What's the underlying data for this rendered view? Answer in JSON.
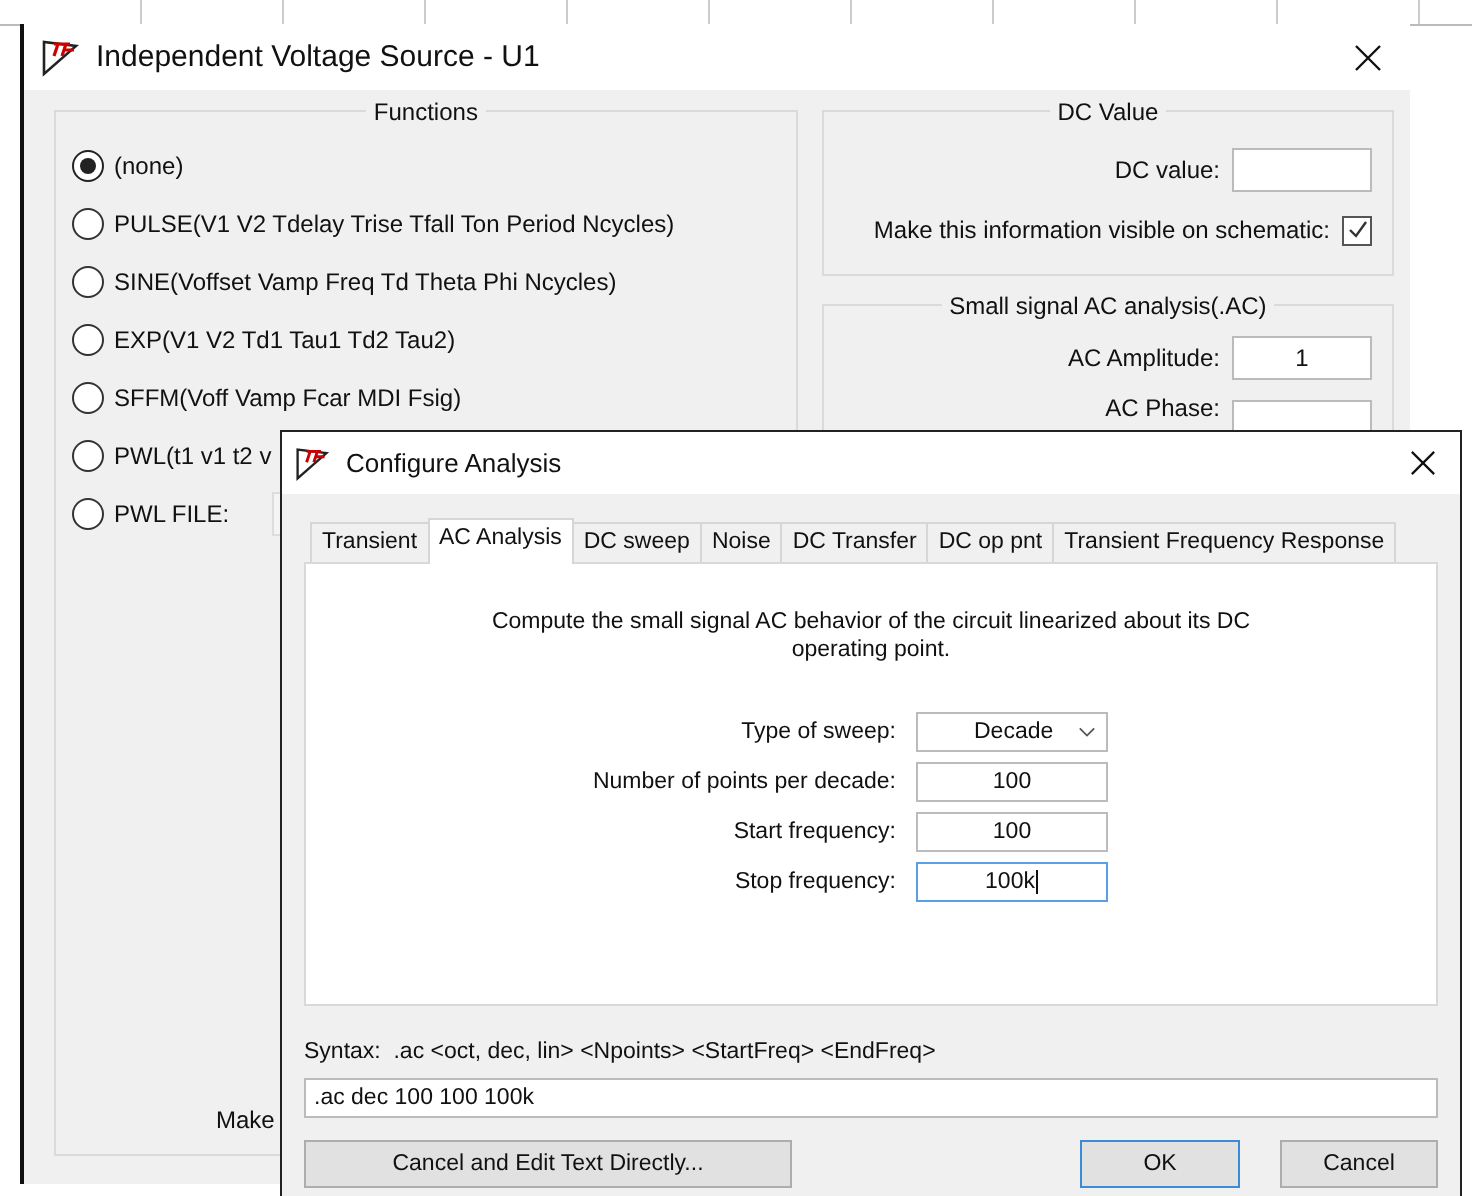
{
  "back_window": {
    "title": "Independent Voltage Source - U1",
    "functions": {
      "title": "Functions",
      "options": [
        {
          "label": "(none)",
          "selected": true
        },
        {
          "label": "PULSE(V1 V2 Tdelay Trise Tfall Ton Period Ncycles)",
          "selected": false
        },
        {
          "label": "SINE(Voffset Vamp Freq Td Theta Phi Ncycles)",
          "selected": false
        },
        {
          "label": "EXP(V1 V2 Td1 Tau1 Td2 Tau2)",
          "selected": false
        },
        {
          "label": "SFFM(Voff Vamp Fcar MDI Fsig)",
          "selected": false
        },
        {
          "label": "PWL(t1 v1 t2 v",
          "selected": false
        },
        {
          "label": "PWL FILE:",
          "selected": false
        }
      ]
    },
    "dc_value": {
      "title": "DC Value",
      "field_label": "DC value:",
      "visible_label": "Make this information visible on schematic:",
      "visible_checked": true
    },
    "ac": {
      "title": "Small signal AC analysis(.AC)",
      "amplitude_label": "AC Amplitude:",
      "amplitude": "1",
      "phase_label": "AC Phase:"
    },
    "bottom_label": "Make"
  },
  "front_window": {
    "title": "Configure Analysis",
    "tabs": [
      {
        "label": "Transient",
        "selected": false
      },
      {
        "label": "AC Analysis",
        "selected": true
      },
      {
        "label": "DC sweep",
        "selected": false
      },
      {
        "label": "Noise",
        "selected": false
      },
      {
        "label": "DC Transfer",
        "selected": false
      },
      {
        "label": "DC op pnt",
        "selected": false
      },
      {
        "label": "Transient Frequency Response",
        "selected": false
      }
    ],
    "description": "Compute the small signal AC behavior of the circuit linearized about its DC operating point.",
    "fields": [
      {
        "kind": "select",
        "label": "Type of sweep:",
        "value": "Decade",
        "focused": false
      },
      {
        "kind": "text",
        "label": "Number of points per decade:",
        "value": "100",
        "focused": false
      },
      {
        "kind": "text",
        "label": "Start frequency:",
        "value": "100",
        "focused": false
      },
      {
        "kind": "text",
        "label": "Stop frequency:",
        "value": "100k",
        "focused": true
      }
    ],
    "syntax": "Syntax:  .ac <oct, dec, lin> <Npoints> <StartFreq> <EndFreq>",
    "command": ".ac dec 100 100 100k",
    "buttons": [
      {
        "label": "Cancel and Edit Text Directly...",
        "default": false
      },
      {
        "label": "OK",
        "default": true
      },
      {
        "label": "Cancel",
        "default": false
      }
    ]
  }
}
